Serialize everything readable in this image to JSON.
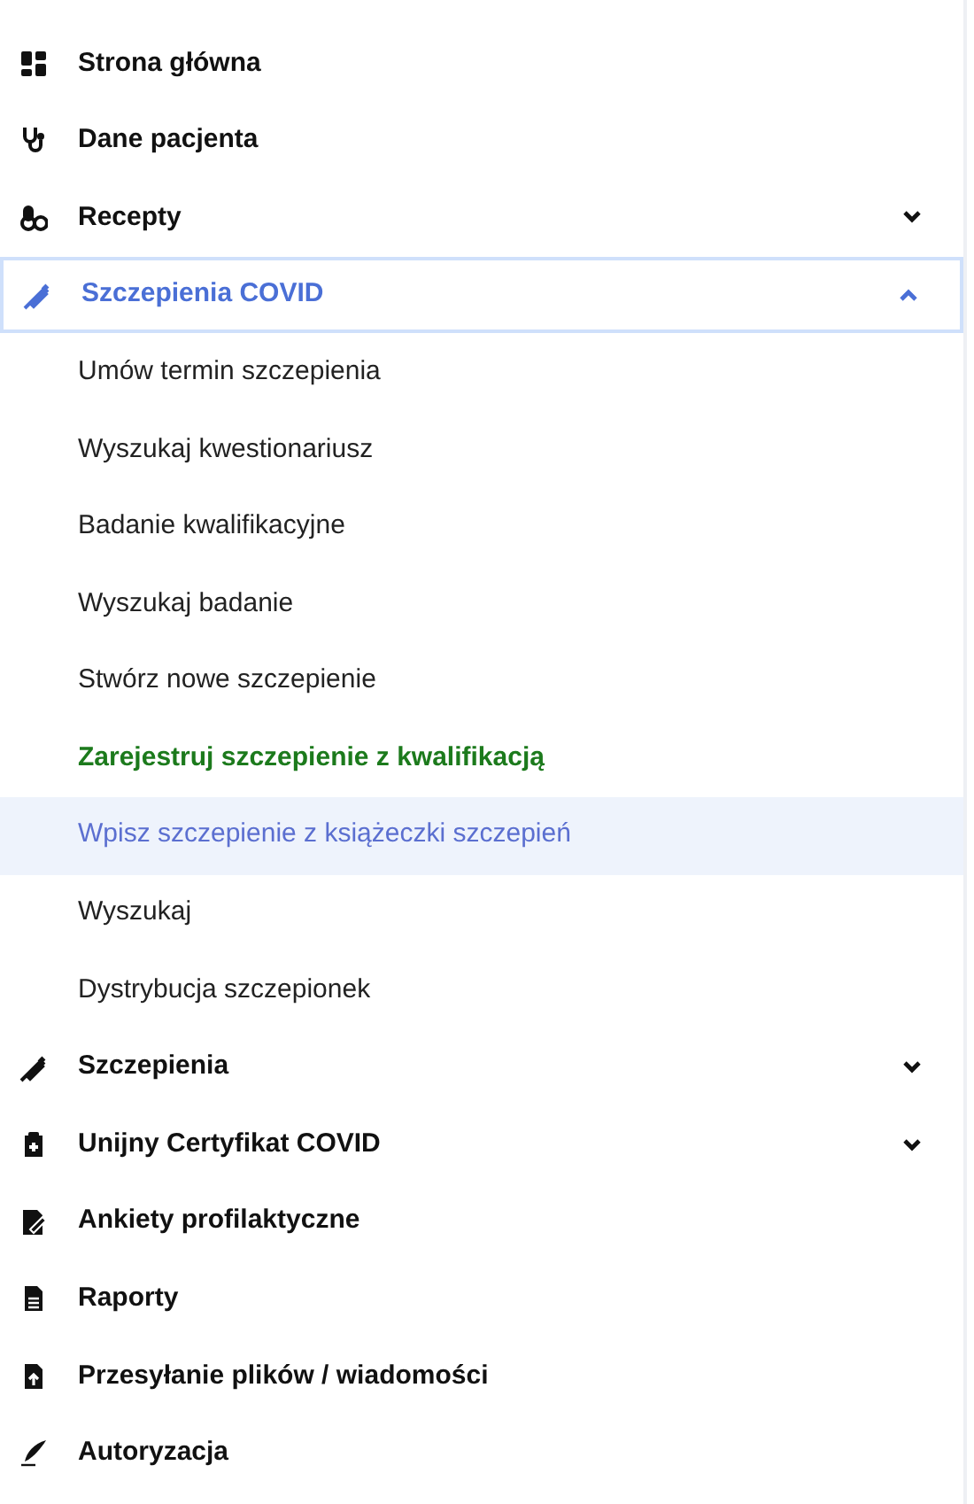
{
  "menu": [
    {
      "label": "Strona główna"
    },
    {
      "label": "Dane pacjenta"
    },
    {
      "label": "Recepty",
      "expanded": false
    },
    {
      "label": "Szczepienia COVID",
      "expanded": true,
      "focused": true,
      "children": [
        {
          "label": "Umów termin szczepienia",
          "selected": false,
          "highlighted": false
        },
        {
          "label": "Wyszukaj kwestionariusz",
          "selected": false,
          "highlighted": false
        },
        {
          "label": "Badanie kwalifikacyjne",
          "selected": false,
          "highlighted": false
        },
        {
          "label": "Wyszukaj badanie",
          "selected": false,
          "highlighted": false
        },
        {
          "label": "Stwórz nowe szczepienie",
          "selected": false,
          "highlighted": false
        },
        {
          "label": "Zarejestruj szczepienie z kwalifikacją",
          "selected": true,
          "highlighted": false
        },
        {
          "label": "Wpisz szczepienie z książeczki szczepień",
          "selected": false,
          "highlighted": true
        },
        {
          "label": "Wyszukaj",
          "selected": false,
          "highlighted": false
        },
        {
          "label": "Dystrybucja szczepionek",
          "selected": false,
          "highlighted": false
        }
      ]
    },
    {
      "label": "Szczepienia",
      "expanded": false
    },
    {
      "label": "Unijny Certyfikat COVID",
      "expanded": false
    },
    {
      "label": "Ankiety profilaktyczne"
    },
    {
      "label": "Raporty"
    },
    {
      "label": "Przesyłanie plików / wiadomości"
    },
    {
      "label": "Autoryzacja"
    }
  ]
}
